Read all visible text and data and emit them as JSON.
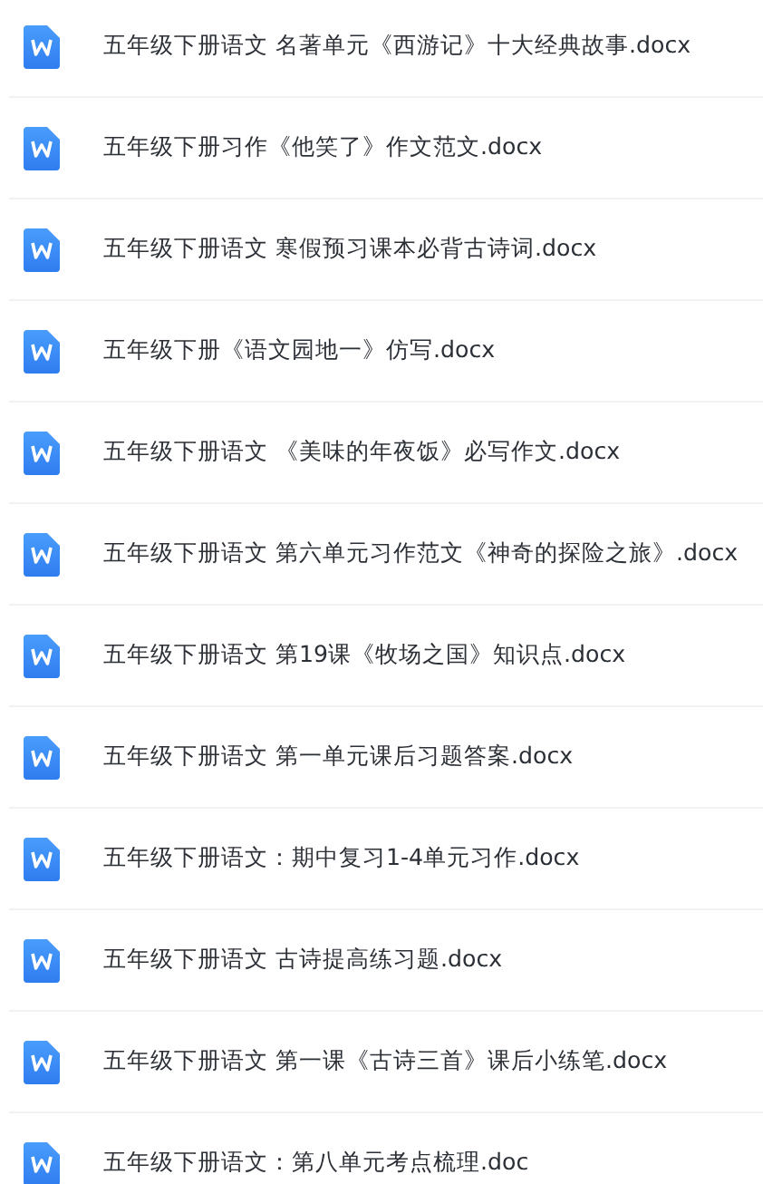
{
  "files": [
    {
      "name": "五年级下册语文 名著单元《西游记》十大经典故事.docx",
      "kind": "word"
    },
    {
      "name": "五年级下册习作《他笑了》作文范文.docx",
      "kind": "word"
    },
    {
      "name": "五年级下册语文 寒假预习课本必背古诗词.docx",
      "kind": "word"
    },
    {
      "name": "五年级下册《语文园地一》仿写.docx",
      "kind": "word"
    },
    {
      "name": "五年级下册语文 《美味的年夜饭》必写作文.docx",
      "kind": "word"
    },
    {
      "name": "五年级下册语文 第六单元习作范文《神奇的探险之旅》.docx",
      "kind": "word"
    },
    {
      "name": "五年级下册语文 第19课《牧场之国》知识点.docx",
      "kind": "word"
    },
    {
      "name": "五年级下册语文 第一单元课后习题答案.docx",
      "kind": "word"
    },
    {
      "name": "五年级下册语文：期中复习1-4单元习作.docx",
      "kind": "word"
    },
    {
      "name": "五年级下册语文 古诗提高练习题.docx",
      "kind": "word"
    },
    {
      "name": "五年级下册语文 第一课《古诗三首》课后小练笔.docx",
      "kind": "word"
    },
    {
      "name": "五年级下册语文：第八单元考点梳理.doc",
      "kind": "word"
    }
  ]
}
